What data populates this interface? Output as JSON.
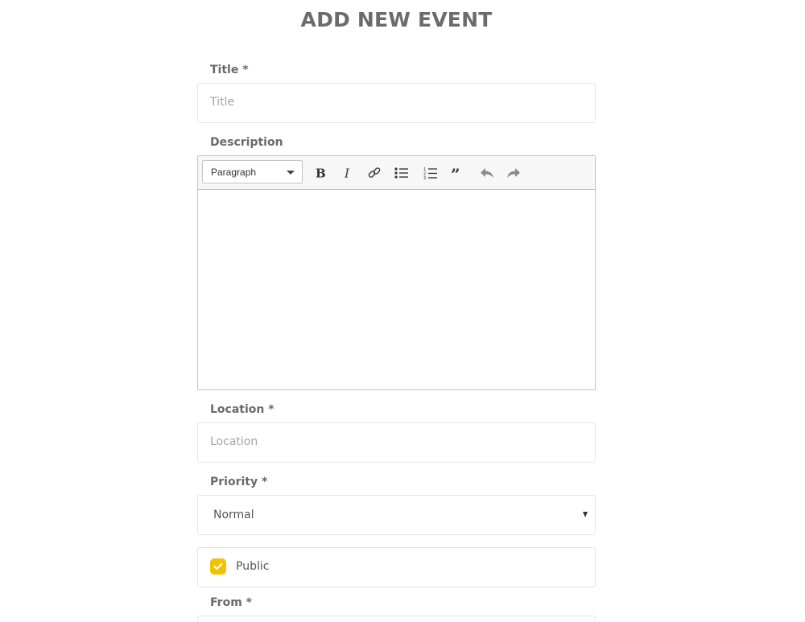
{
  "page": {
    "title": "ADD NEW EVENT"
  },
  "form": {
    "title": {
      "label": "Title *",
      "placeholder": "Title",
      "value": ""
    },
    "description": {
      "label": "Description",
      "toolbar": {
        "heading_select": "Paragraph",
        "buttons": [
          "bold-icon",
          "italic-icon",
          "link-icon",
          "bulleted-list-icon",
          "numbered-list-icon",
          "blockquote-icon",
          "undo-icon",
          "redo-icon"
        ]
      },
      "content": ""
    },
    "location": {
      "label": "Location *",
      "placeholder": "Location",
      "value": ""
    },
    "priority": {
      "label": "Priority *",
      "selected": "Normal"
    },
    "public": {
      "label": "Public",
      "checked": true
    },
    "from": {
      "label": "From *"
    }
  },
  "colors": {
    "checkbox": "#f2c200",
    "text": "#666666",
    "border": "#e4e4e4"
  }
}
